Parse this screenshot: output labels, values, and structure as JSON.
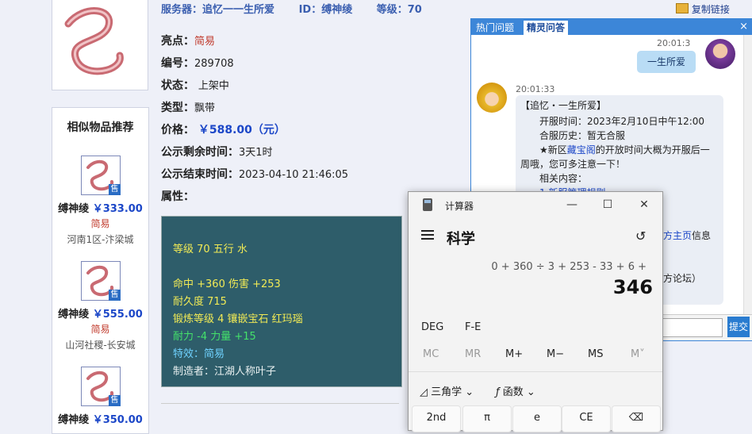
{
  "header": {
    "server_label": "服务器：",
    "server_value": "追忆一一生所爱",
    "id_label": "ID：",
    "id_value": "缚神绫",
    "level_label": "等级：",
    "level_value": "70",
    "copy_link": "复制链接"
  },
  "item": {
    "rows": [
      {
        "label": "亮点：",
        "value": "简易"
      },
      {
        "label": "编号：",
        "value": "289708"
      },
      {
        "label": "状态：",
        "value": "上架中"
      },
      {
        "label": "类型：",
        "value": "飘带"
      },
      {
        "label": "价格：",
        "value": "￥588.00（元）"
      },
      {
        "label": "公示剩余时间：",
        "value": "3天1时"
      },
      {
        "label": "公示结束时间：",
        "value": "2023-04-10 21:46:05"
      },
      {
        "label": "属性：",
        "value": ""
      }
    ]
  },
  "attributes": {
    "line1": "等级 70 五行 水",
    "line2": "命中 +360 伤害 +253",
    "line3": "耐久度 715",
    "line4": "锻炼等级 4 镶嵌宝石 红玛瑙",
    "line5": "耐力 -4 力量 +15",
    "line6": "特效：简易",
    "line7": "制造者：江湖人称叶子"
  },
  "similar": {
    "title": "相似物品推荐",
    "items": [
      {
        "name": "缚神绫",
        "price": "￥333.00",
        "tag": "简易",
        "server": "河南1区-汴梁城",
        "badge": "售"
      },
      {
        "name": "缚神绫",
        "price": "￥555.00",
        "tag": "简易",
        "server": "山河社稷-长安城",
        "badge": "售"
      },
      {
        "name": "缚神绫",
        "price": "￥350.00",
        "tag": "",
        "server": "",
        "badge": "售"
      }
    ]
  },
  "chat": {
    "tab1": "热门问题",
    "tab2": "精灵问答",
    "close": "×",
    "my_time": "20:01:3",
    "my_message": "一生所爱",
    "reply_time": "20:01:33",
    "reply": {
      "l1": "【追忆・一生所爱】",
      "l2": "开服时间：2023年2月10日中午12:00",
      "l3": "合服历史：暂无合服",
      "l4a": "★新区",
      "l4link": "藏宝阁",
      "l4b": "的开放时间大概为开服后一",
      "l5": "周哦，您可多注意一下！",
      "l6": "相关内容：",
      "l7": "1.新服管理规则",
      "l8a": "方主页",
      "l8b": "信息",
      "l9": "方论坛）"
    },
    "send": "提交"
  },
  "calculator": {
    "title": "计算器",
    "mode": "科学",
    "expression": "0 + 360 ÷ 3 + 253 - 33 + 6 +",
    "result": "346",
    "deg": "DEG",
    "fe": "F-E",
    "mc": "MC",
    "mr": "MR",
    "mplus": "M+",
    "mminus": "M−",
    "ms": "MS",
    "mv": "M˅",
    "trig": "三角学",
    "func": "函数",
    "btn_2nd": "2nd",
    "btn_pi": "π",
    "btn_e": "e",
    "btn_ce": "CE",
    "btn_back": "⌫"
  },
  "colors": {
    "accent": "#3c86d8",
    "price": "#1c47c8",
    "highlight": "#c0392b",
    "attr_bg": "#2e5d6a"
  }
}
